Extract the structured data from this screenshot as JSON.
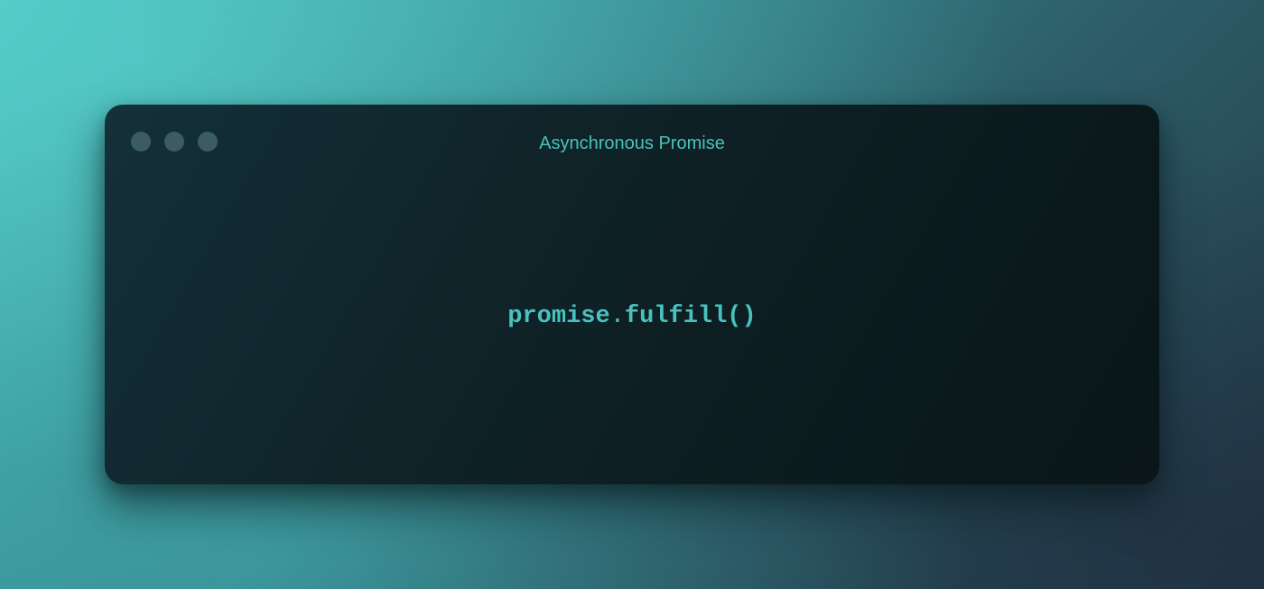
{
  "window": {
    "title": "Asynchronous Promise",
    "controls": [
      "close-dot",
      "minimize-dot",
      "zoom-dot"
    ]
  },
  "code": {
    "object": "promise",
    "separator": ".",
    "method": "fulfill()"
  },
  "colors": {
    "accent": "#49c2bf",
    "window_bg": "#0f2328",
    "dot": "#3b5c63",
    "background_start": "#4fc4c1",
    "background_end": "#233746"
  }
}
